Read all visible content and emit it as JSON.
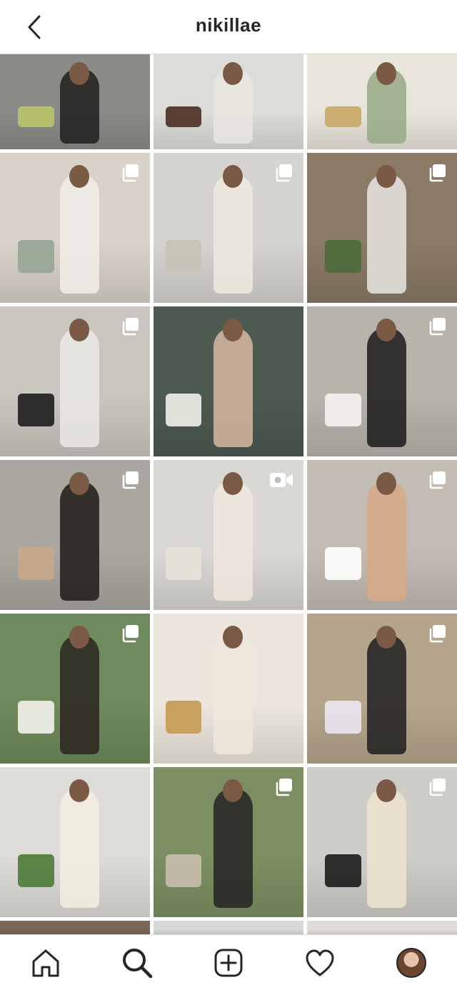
{
  "header": {
    "title": "nikillae",
    "back_icon": "chevron-left-icon"
  },
  "grid": {
    "rows": [
      [
        {
          "bg": "#8a8a86",
          "figure": "#1e1e1e",
          "prop": "#b9c46a",
          "badge": ""
        },
        {
          "bg": "#dcdcd8",
          "figure": "#e9e6df",
          "prop": "#4a2e22",
          "badge": ""
        },
        {
          "bg": "#e9e5dc",
          "figure": "#96a986",
          "prop": "#c9a765",
          "badge": ""
        }
      ],
      [
        {
          "bg": "#d8d2c8",
          "figure": "#f1efea",
          "prop": "#98a594",
          "badge": "carousel-icon"
        },
        {
          "bg": "#d6d4d0",
          "figure": "#efeadf",
          "prop": "#c8c2b6",
          "badge": "carousel-icon"
        },
        {
          "bg": "#8a7a66",
          "figure": "#e7e6e2",
          "prop": "#4e6b3a",
          "badge": "carousel-icon"
        }
      ],
      [
        {
          "bg": "#c9c6bf",
          "figure": "#ebe9e6",
          "prop": "#1d1d1d",
          "badge": "carousel-icon"
        },
        {
          "bg": "#4c5a50",
          "figure": "#d7b8a2",
          "prop": "#f2efe9",
          "badge": ""
        },
        {
          "bg": "#b8b3ab",
          "figure": "#1a1a1a",
          "prop": "#f5f3ef",
          "badge": "carousel-icon"
        }
      ],
      [
        {
          "bg": "#a9a79f",
          "figure": "#1f1b18",
          "prop": "#c9a88a",
          "badge": "carousel-icon"
        },
        {
          "bg": "#d9d8d5",
          "figure": "#f1e8dd",
          "prop": "#e8e2d8",
          "badge": "video-icon"
        },
        {
          "bg": "#c3bcb4",
          "figure": "#d9a987",
          "prop": "#ffffff",
          "badge": "carousel-icon"
        }
      ],
      [
        {
          "bg": "#6f8a5c",
          "figure": "#2c2420",
          "prop": "#f3f1ec",
          "badge": "carousel-icon"
        },
        {
          "bg": "#ece6dd",
          "figure": "#efe8dc",
          "prop": "#c49a52",
          "badge": ""
        },
        {
          "bg": "#b5a58d",
          "figure": "#1e1e1e",
          "prop": "#ebe7f1",
          "badge": "carousel-icon"
        }
      ],
      [
        {
          "bg": "#dedcd8",
          "figure": "#f3eee2",
          "prop": "#4f7a37",
          "badge": ""
        },
        {
          "bg": "#7d8f62",
          "figure": "#232323",
          "prop": "#c9bfae",
          "badge": "carousel-icon"
        },
        {
          "bg": "#cfcdc8",
          "figure": "#ede4cf",
          "prop": "#1b1b1b",
          "badge": "carousel-icon"
        }
      ],
      [
        {
          "bg": "#7a6656",
          "figure": "#7a6656",
          "prop": "#7a6656",
          "badge": ""
        },
        {
          "bg": "#d8d8d6",
          "figure": "#d8d8d6",
          "prop": "#d8d8d6",
          "badge": ""
        },
        {
          "bg": "#e0ddd8",
          "figure": "#e0ddd8",
          "prop": "#e0ddd8",
          "badge": ""
        }
      ]
    ]
  },
  "bottom_nav": {
    "items": [
      {
        "name": "home-icon"
      },
      {
        "name": "search-icon"
      },
      {
        "name": "new-post-icon"
      },
      {
        "name": "heart-icon"
      },
      {
        "name": "profile-avatar"
      }
    ]
  }
}
